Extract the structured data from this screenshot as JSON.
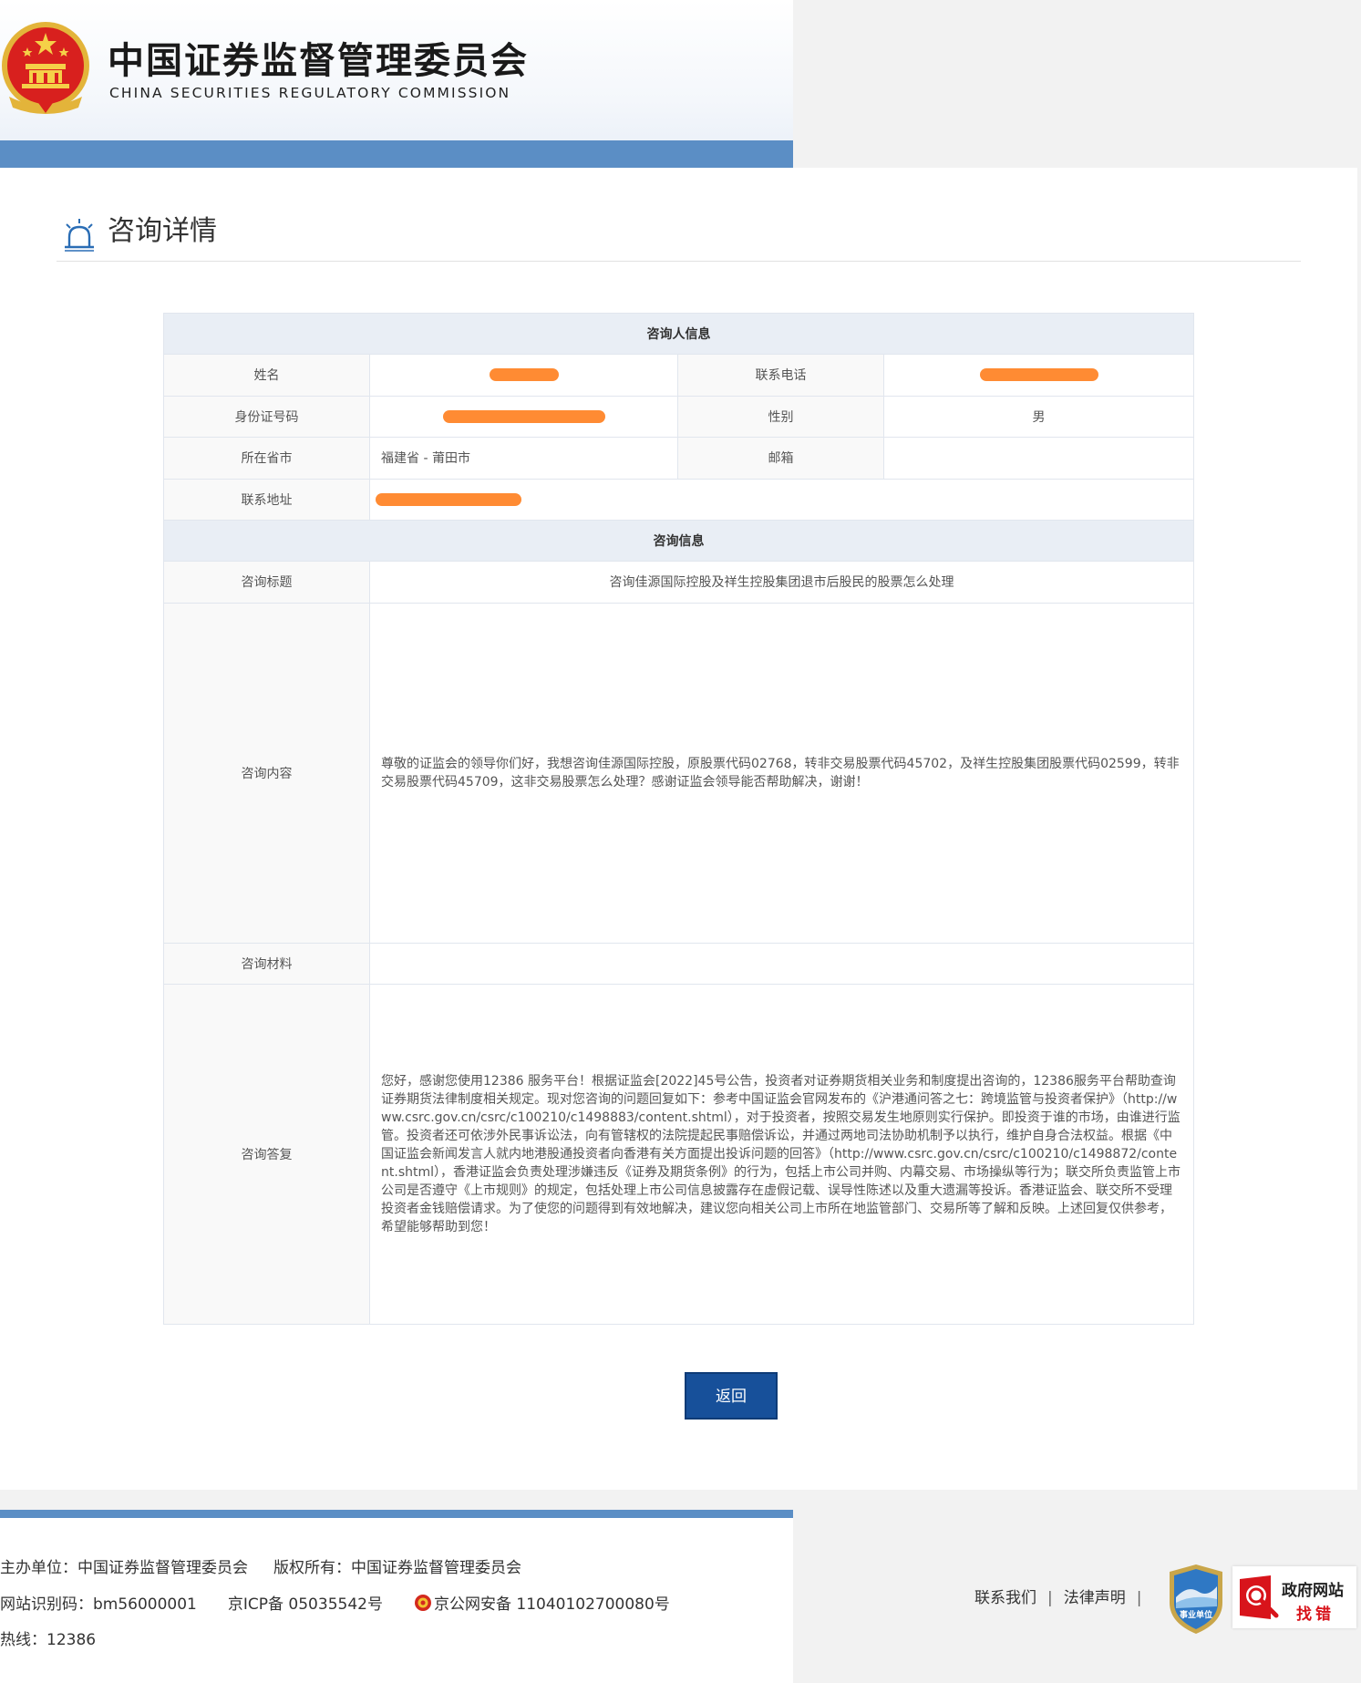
{
  "header": {
    "title": "中国证券监督管理委员会",
    "subtitle": "CHINA SECURITIES REGULATORY COMMISSION"
  },
  "page": {
    "title": "咨询详情"
  },
  "consultant": {
    "section_title": "咨询人信息",
    "name_label": "姓名",
    "phone_label": "联系电话",
    "id_label": "身份证号码",
    "gender_label": "性别",
    "gender_value": "男",
    "province_label": "所在省市",
    "province_value": "福建省 - 莆田市",
    "email_label": "邮箱",
    "email_value": "",
    "address_label": "联系地址"
  },
  "consultation": {
    "section_title": "咨询信息",
    "subject_label": "咨询标题",
    "subject_value": "咨询佳源国际控股及祥生控股集团退市后股民的股票怎么处理",
    "content_label": "咨询内容",
    "content_value": "尊敬的证监会的领导你们好，我想咨询佳源国际控股，原股票代码02768，转非交易股票代码45702，及祥生控股集团股票代码02599，转非交易股票代码45709，这非交易股票怎么处理？感谢证监会领导能否帮助解决，谢谢！",
    "material_label": "咨询材料",
    "material_value": "",
    "reply_label": "咨询答复",
    "reply_value": "您好，感谢您使用12386 服务平台！根据证监会[2022]45号公告，投资者对证券期货相关业务和制度提出咨询的，12386服务平台帮助查询证券期货法律制度相关规定。现对您咨询的问题回复如下：参考中国证监会官网发布的《沪港通问答之七：跨境监管与投资者保护》（http://www.csrc.gov.cn/csrc/c100210/c1498883/content.shtml），对于投资者，按照交易发生地原则实行保护。即投资于谁的市场，由谁进行监管。投资者还可依涉外民事诉讼法，向有管辖权的法院提起民事赔偿诉讼，并通过两地司法协助机制予以执行，维护自身合法权益。根据《中国证监会新闻发言人就内地港股通投资者向香港有关方面提出投诉问题的回答》（http://www.csrc.gov.cn/csrc/c100210/c1498872/content.shtml），香港证监会负责处理涉嫌违反《证券及期货条例》的行为，包括上市公司并购、内幕交易、市场操纵等行为；联交所负责监管上市公司是否遵守《上市规则》的规定，包括处理上市公司信息披露存在虚假记载、误导性陈述以及重大遗漏等投诉。香港证监会、联交所不受理投资者金钱赔偿请求。为了使您的问题得到有效地解决，建议您向相关公司上市所在地监管部门、交易所等了解和反映。上述回复仅供参考，希望能够帮助到您！"
  },
  "actions": {
    "back_label": "返回"
  },
  "footer": {
    "sponsor": "主办单位：中国证券监督管理委员会",
    "copyright": "版权所有：中国证券监督管理委员会",
    "site_code": "网站识别码：bm56000001",
    "icp": "京ICP备 05035542号",
    "police": "京公网安备 11040102700080号",
    "hotline": "热线：12386",
    "contact_us": "联系我们",
    "legal": "法律声明",
    "sep": "|",
    "badge_institution_text": "事业单位",
    "badge_error_line1": "政府网站",
    "badge_error_line2": "找错"
  },
  "colors": {
    "header_bar": "#5b8ec5",
    "button": "#17509a",
    "redaction": "#ff8b33",
    "section_bg": "#e9eef5"
  }
}
